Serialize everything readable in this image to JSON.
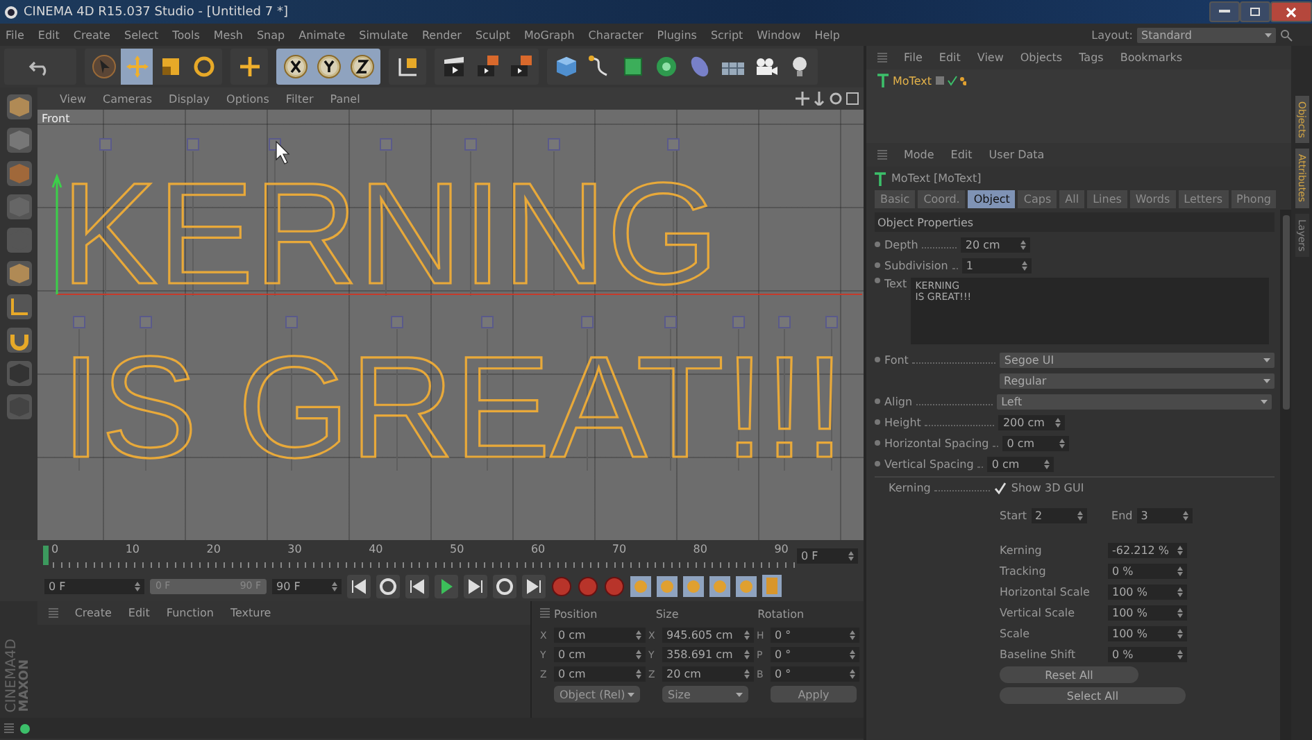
{
  "window": {
    "title": "CINEMA 4D R15.037 Studio - [Untitled 7 *]"
  },
  "menu": [
    "File",
    "Edit",
    "Create",
    "Select",
    "Tools",
    "Mesh",
    "Snap",
    "Animate",
    "Simulate",
    "Render",
    "Sculpt",
    "MoGraph",
    "Character",
    "Plugins",
    "Script",
    "Window",
    "Help"
  ],
  "layout": {
    "label": "Layout:",
    "value": "Standard"
  },
  "viewport": {
    "menu": [
      "View",
      "Cameras",
      "Display",
      "Options",
      "Filter",
      "Panel"
    ],
    "camera": "Front",
    "text_lines": [
      "KERNING",
      "IS GREAT!!!"
    ]
  },
  "timeline": {
    "ticks": [
      "0",
      "10",
      "20",
      "30",
      "40",
      "50",
      "60",
      "70",
      "80",
      "90"
    ],
    "current": "0 F",
    "start": "0 F",
    "range": {
      "start": "0 F",
      "end": "90 F",
      "level": 1
    },
    "end": "90 F"
  },
  "branding": [
    "MAXON",
    "CINEMA4D"
  ],
  "material_manager": {
    "menu": [
      "Create",
      "Edit",
      "Function",
      "Texture"
    ]
  },
  "coordinates": {
    "headers": [
      "Position",
      "Size",
      "Rotation"
    ],
    "rows": [
      {
        "axis": "X",
        "position": "0 cm",
        "size_axis": "X",
        "size": "945.605 cm",
        "rot_axis": "H",
        "rotation": "0 °"
      },
      {
        "axis": "Y",
        "position": "0 cm",
        "size_axis": "Y",
        "size": "358.691 cm",
        "rot_axis": "P",
        "rotation": "0 °"
      },
      {
        "axis": "Z",
        "position": "0 cm",
        "size_axis": "Z",
        "size": "20 cm",
        "rot_axis": "B",
        "rotation": "0 °"
      }
    ],
    "mode": "Object (Rel)",
    "size_mode": "Size",
    "apply": "Apply"
  },
  "object_manager": {
    "menu": [
      "File",
      "Edit",
      "View",
      "Objects",
      "Tags",
      "Bookmarks"
    ],
    "objects": [
      {
        "name": "MoText",
        "selected": true
      }
    ]
  },
  "attributes": {
    "menu": [
      "Mode",
      "Edit",
      "User Data"
    ],
    "title": "MoText [MoText]",
    "tabs": [
      {
        "label": "Basic",
        "selected": false
      },
      {
        "label": "Coord.",
        "selected": false
      },
      {
        "label": "Object",
        "selected": true
      },
      {
        "label": "Caps",
        "selected": false
      },
      {
        "label": "All",
        "selected": false
      },
      {
        "label": "Lines",
        "selected": false
      },
      {
        "label": "Words",
        "selected": false
      },
      {
        "label": "Letters",
        "selected": false
      },
      {
        "label": "Phong",
        "selected": false
      }
    ],
    "section": "Object Properties",
    "fields": [
      {
        "kind": "number",
        "label": "Depth",
        "value": "20 cm"
      },
      {
        "kind": "number",
        "label": "Subdivision",
        "value": "1"
      },
      {
        "kind": "textarea",
        "label": "Text",
        "value": "KERNING\nIS GREAT!!!"
      },
      {
        "kind": "dropdown",
        "label": "Font",
        "value": "Segoe UI"
      },
      {
        "kind": "dropdown",
        "value": "Regular"
      },
      {
        "kind": "dropdown",
        "label": "Align",
        "value": "Left"
      },
      {
        "kind": "number",
        "label": "Height",
        "value": "200 cm"
      },
      {
        "kind": "number",
        "label": "Horizontal Spacing",
        "value": "0 cm"
      },
      {
        "kind": "number",
        "label": "Vertical Spacing",
        "value": "0 cm"
      }
    ],
    "kerning": {
      "label": "Kerning",
      "show_label": "Show 3D GUI",
      "checked": true,
      "start_label": "Start",
      "start": "2",
      "end_label": "End",
      "end": "3",
      "fields": [
        {
          "label": "Kerning",
          "value": "-62.212 %"
        },
        {
          "label": "Tracking",
          "value": "0 %"
        },
        {
          "label": "Horizontal Scale",
          "value": "100 %"
        },
        {
          "label": "Vertical Scale",
          "value": "100 %"
        },
        {
          "label": "Scale",
          "value": "100 %"
        },
        {
          "label": "Baseline Shift",
          "value": "0 %"
        }
      ],
      "buttons": [
        "Reset All",
        "Select All"
      ]
    }
  },
  "side_tabs": [
    {
      "label": "Objects",
      "selected": true
    },
    {
      "label": "Attributes",
      "selected": true
    },
    {
      "label": "Layers",
      "selected": false
    }
  ]
}
